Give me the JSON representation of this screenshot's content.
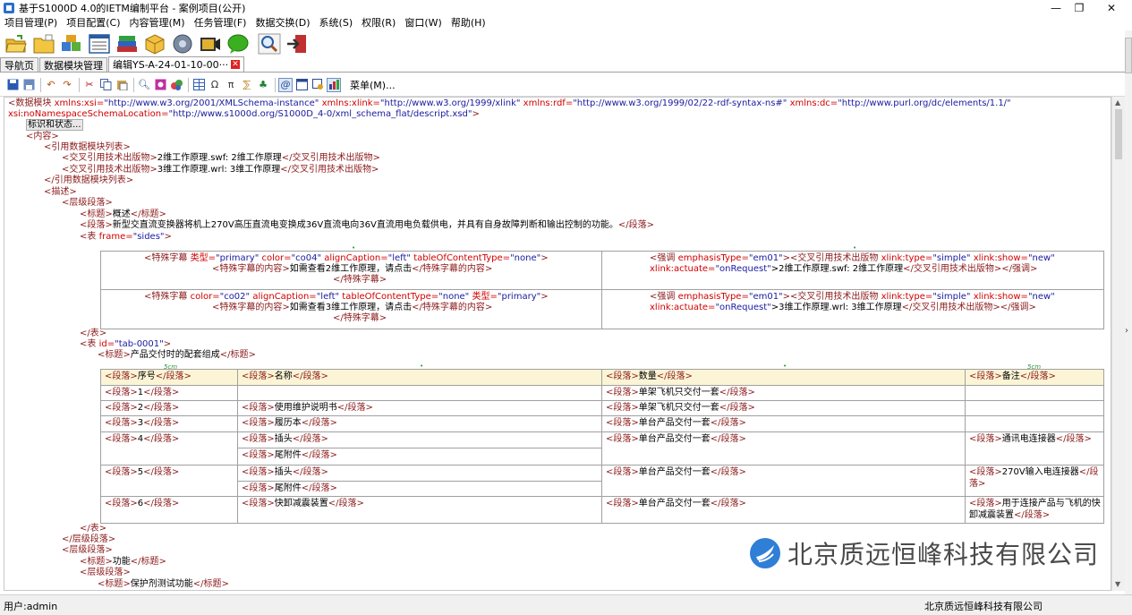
{
  "window": {
    "title": "基于S1000D 4.0的IETM编制平台 - 案例项目(公开)",
    "minimize": "—",
    "restore": "❐",
    "close": "✕"
  },
  "menu": [
    "项目管理(P)",
    "项目配置(C)",
    "内容管理(M)",
    "任务管理(F)",
    "数据交换(D)",
    "系统(S)",
    "权限(R)",
    "窗口(W)",
    "帮助(H)"
  ],
  "toolbar_icons": [
    "open-folder-icon",
    "folder-icon",
    "modules-icon",
    "list-icon",
    "books-icon",
    "package-icon",
    "media-icon",
    "video-icon",
    "chat-icon",
    "search-icon",
    "exit-icon"
  ],
  "tabs": [
    {
      "label": "导航页",
      "active": false
    },
    {
      "label": "数据模块管理",
      "active": false
    },
    {
      "label": "编辑YS-A-24-01-10-00···",
      "active": true
    }
  ],
  "editor_toolbar": {
    "menu_label": "菜单(M)..."
  },
  "xml": {
    "l1": {
      "tag": "<数据模块",
      "a1n": "xmlns:xsi=",
      "a1v": "\"http://www.w3.org/2001/XMLSchema-instance\"",
      "a2n": "xmlns:xlink=",
      "a2v": "\"http://www.w3.org/1999/xlink\"",
      "a3n": "xmlns:rdf=",
      "a3v": "\"http://www.w3.org/1999/02/22-rdf-syntax-ns#\"",
      "a4n": "xmlns:dc=",
      "a4v": "\"http://www.purl.org/dc/elements/1.1/\""
    },
    "l2": {
      "a5n": "xsi:noNamespaceSchemaLocation=",
      "a5v": "\"http://www.s1000d.org/S1000D_4-0/xml_schema_flat/descript.xsd\"",
      "close": ">"
    },
    "ident": "标识和状态...",
    "content_open": "<内容>",
    "refs_open": "<引用数据模块列表>",
    "ref1": {
      "open": "<交叉引用技术出版物>",
      "text": "2维工作原理.swf: 2维工作原理",
      "close": "</交叉引用技术出版物>"
    },
    "ref2": {
      "open": "<交叉引用技术出版物>",
      "text": "3维工作原理.wrl: 3维工作原理",
      "close": "</交叉引用技术出版物>"
    },
    "refs_close": "</引用数据模块列表>",
    "desc_open": "<描述>",
    "lvl_open": "<层级段落>",
    "title1": {
      "open": "<标题>",
      "text": "概述",
      "close": "</标题>"
    },
    "para1": {
      "open": "<段落>",
      "text": "新型交直流变换器将机上270V高压直流电变换成36V直流电向36V直流用电负载供电，并具有自身故障判断和输出控制的功能。",
      "close": "</段落>"
    },
    "table1_open": {
      "tag": "<表",
      "an": "frame=",
      "av": "\"sides\"",
      "close": ">"
    },
    "t1c1r1": {
      "tag": "<特殊字幕",
      "a1n": "类型=",
      "a1v": "\"primary\"",
      "a2n": "color=",
      "a2v": "\"co04\"",
      "a3n": "alignCaption=",
      "a3v": "\"left\"",
      "a4n": "tableOfContentType=",
      "a4v": "\"none\"",
      "close": ">",
      "l2o": "<特殊字幕的内容>",
      "l2t": "如需查看2维工作原理，请点击",
      "l2c": "</特殊字幕的内容>",
      "l3": "</特殊字幕>"
    },
    "t1c2r1": {
      "tag": "<强调",
      "a1n": "emphasisType=",
      "a1v": "\"em01\"",
      "mid": "><交叉引用技术出版物",
      "a2n": "xlink:type=",
      "a2v": "\"simple\"",
      "a3n": "xlink:show=",
      "a3v": "\"new\"",
      "a4n": "xlink:actuate=",
      "a4v": "\"onRequest\"",
      "text": ">2维工作原理.swf: 2维工作原理",
      "close": "</交叉引用技术出版物></强调>"
    },
    "t1c1r2": {
      "tag": "<特殊字幕",
      "a1n": "color=",
      "a1v": "\"co02\"",
      "a2n": "alignCaption=",
      "a2v": "\"left\"",
      "a3n": "tableOfContentType=",
      "a3v": "\"none\"",
      "a4n": "类型=",
      "a4v": "\"primary\"",
      "close": ">",
      "l2o": "<特殊字幕的内容>",
      "l2t": "如需查看3维工作原理，请点击",
      "l2c": "</特殊字幕的内容>",
      "l3": "</特殊字幕>"
    },
    "t1c2r2": {
      "tag": "<强调",
      "a1n": "emphasisType=",
      "a1v": "\"em01\"",
      "mid": "><交叉引用技术出版物",
      "a2n": "xlink:type=",
      "a2v": "\"simple\"",
      "a3n": "xlink:show=",
      "a3v": "\"new\"",
      "a4n": "xlink:actuate=",
      "a4v": "\"onRequest\"",
      "text": ">3维工作原理.wrl: 3维工作原理",
      "close": "</交叉引用技术出版物></强调>"
    },
    "table1_close": "</表>",
    "table2_open": {
      "tag": "<表",
      "an": "id=",
      "av": "\"tab-0001\"",
      "close": ">"
    },
    "title2": {
      "open": "<标题>",
      "text": "产品交付时的配套组成",
      "close": "</标题>"
    },
    "colwidth": "5cm",
    "table2_close": "</表>",
    "lvl_close": "</层级段落>",
    "lvl2_open": "<层级段落>",
    "title3": {
      "open": "<标题>",
      "text": "功能",
      "close": "</标题>"
    },
    "lvl3_open": "<层级段落>",
    "title4": {
      "open": "<标题>",
      "text": "保护剂测试功能",
      "close": "</标题>"
    }
  },
  "table2": {
    "para_open": "<段落>",
    "para_close": "</段落>",
    "header": [
      "序号",
      "名称",
      "数量",
      "备注"
    ],
    "rows": [
      {
        "no": "1",
        "names": [],
        "qty": "单架飞机只交付一套",
        "note": ""
      },
      {
        "no": "2",
        "names": [
          "使用维护说明书"
        ],
        "qty": "单架飞机只交付一套",
        "note": ""
      },
      {
        "no": "3",
        "names": [
          "履历本"
        ],
        "qty": "单台产品交付一套",
        "note": ""
      },
      {
        "no": "4",
        "names": [
          "插头",
          "尾附件"
        ],
        "qty": "单台产品交付一套",
        "note": "通讯电连接器"
      },
      {
        "no": "5",
        "names": [
          "插头",
          "尾附件"
        ],
        "qty": "单台产品交付一套",
        "note": "270V输入电连接器"
      },
      {
        "no": "6",
        "names": [
          "快卸减震装置"
        ],
        "qty": "单台产品交付一套",
        "note": "用于连接产品与飞机的快卸减震装置"
      }
    ]
  },
  "status": {
    "user": "用户:admin",
    "company": "北京质远恒峰科技有限公司"
  },
  "watermark": {
    "text": "北京质远恒峰科技有限公司"
  }
}
